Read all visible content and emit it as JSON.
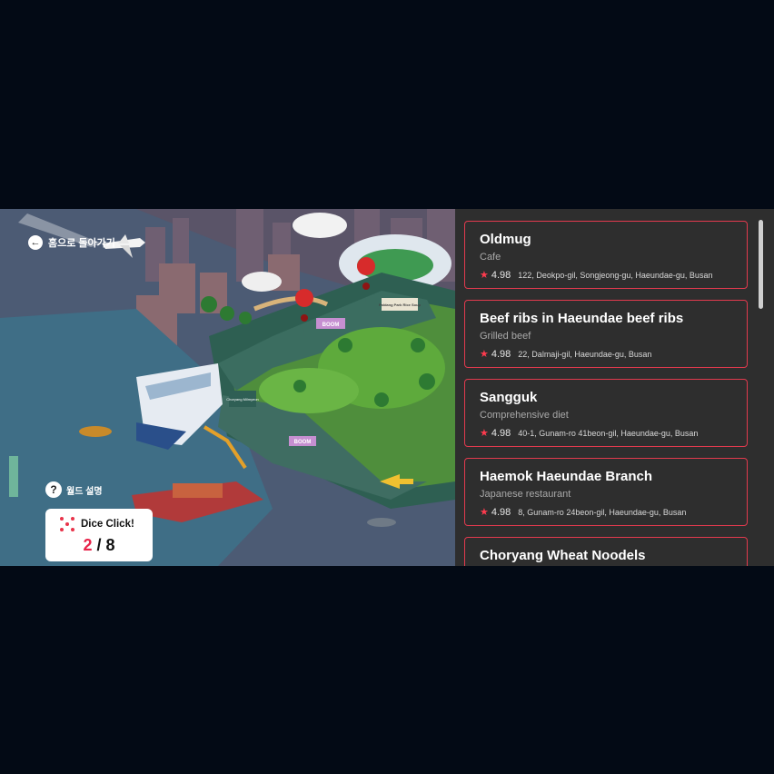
{
  "map": {
    "back_label": "홈으로 돌아가기",
    "world_label": "월드 설명",
    "dice": {
      "label": "Dice Click!",
      "current": "2",
      "separator": "/",
      "total": "8"
    },
    "board_labels": [
      "BOOM",
      "BOOM",
      "Paldang Park Rice Soup",
      "Choryang Milmyeon"
    ]
  },
  "restaurants": [
    {
      "name": "Oldmug",
      "category": "Cafe",
      "rating": "4.98",
      "address": "122, Deokpo-gil, Songjeong-gu, Haeundae-gu, Busan"
    },
    {
      "name": "Beef ribs in Haeundae beef ribs",
      "category": "Grilled beef",
      "rating": "4.98",
      "address": "22, Dalmaji-gil, Haeundae-gu, Busan"
    },
    {
      "name": "Sangguk",
      "category": "Comprehensive diet",
      "rating": "4.98",
      "address": "40-1, Gunam-ro 41beon-gil, Haeundae-gu, Busan"
    },
    {
      "name": "Haemok Haeundae Branch",
      "category": "Japanese restaurant",
      "rating": "4.98",
      "address": "8, Gunam-ro 24beon-gil, Haeundae-gu, Busan"
    },
    {
      "name": "Choryang Wheat Noodels",
      "category": "",
      "rating": "",
      "address": ""
    }
  ],
  "colors": {
    "card_border": "#e23a4e",
    "accent": "#e8234a",
    "panel_bg": "#2e2e2e",
    "page_bg": "#030a15"
  }
}
